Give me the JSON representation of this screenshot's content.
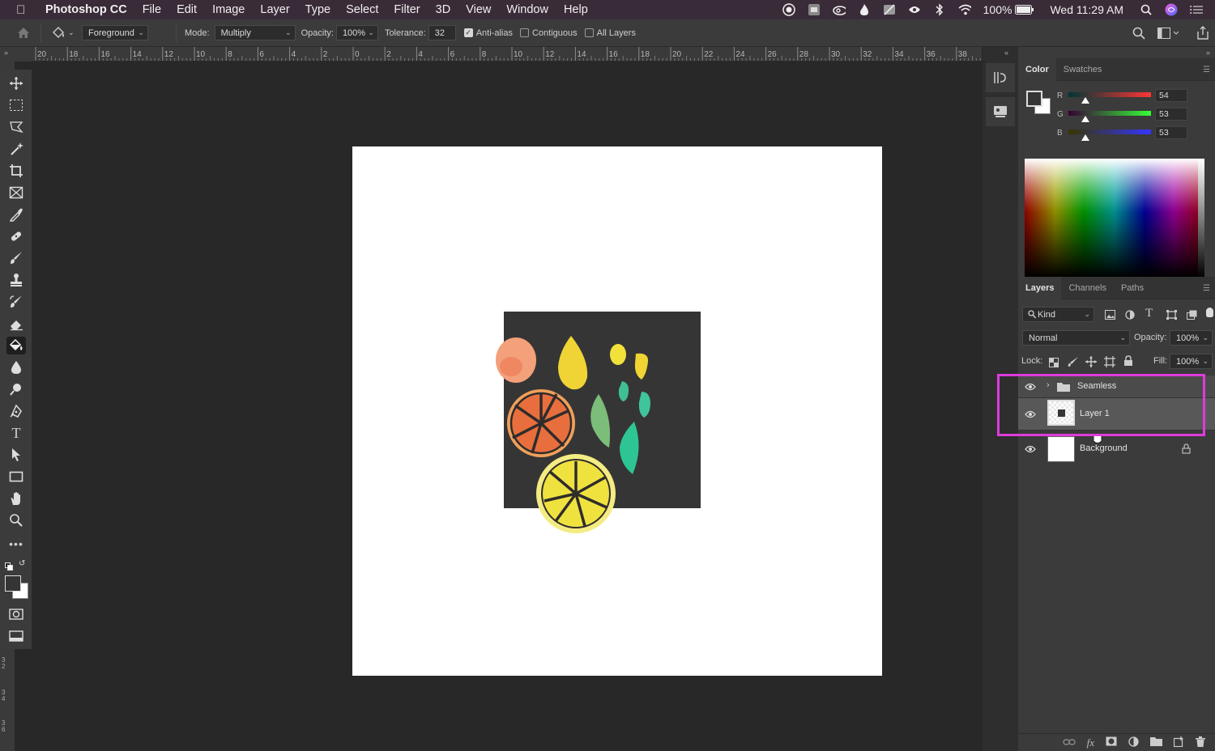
{
  "menubar": {
    "app_name": "Photoshop CC",
    "items": [
      "File",
      "Edit",
      "Image",
      "Layer",
      "Type",
      "Select",
      "Filter",
      "3D",
      "View",
      "Window",
      "Help"
    ],
    "battery": "100%",
    "clock": "Wed 11:29 AM"
  },
  "options": {
    "fill_source": "Foreground",
    "mode_label": "Mode:",
    "mode_value": "Multiply",
    "opacity_label": "Opacity:",
    "opacity_value": "100%",
    "tolerance_label": "Tolerance:",
    "tolerance_value": "32",
    "anti_alias_label": "Anti-alias",
    "anti_alias_checked": true,
    "contiguous_label": "Contiguous",
    "contiguous_checked": false,
    "all_layers_label": "All Layers",
    "all_layers_checked": false
  },
  "ruler": {
    "labels": [
      "20",
      "18",
      "16",
      "14",
      "12",
      "10",
      "8",
      "6",
      "4",
      "2",
      "0",
      "2",
      "4",
      "6",
      "8",
      "10",
      "12",
      "14",
      "16",
      "18",
      "20",
      "22",
      "24",
      "26",
      "28",
      "30",
      "32",
      "34",
      "36",
      "38"
    ]
  },
  "vruler": {
    "labels": [
      "3 2",
      "3 4",
      "3 6"
    ]
  },
  "color_panel": {
    "tabs": [
      "Color",
      "Swatches"
    ],
    "channels": [
      {
        "name": "R",
        "value": "54",
        "level": 0.21
      },
      {
        "name": "G",
        "value": "53",
        "level": 0.21
      },
      {
        "name": "B",
        "value": "53",
        "level": 0.21
      }
    ],
    "foreground": "#363535",
    "background": "#ffffff"
  },
  "layers_panel": {
    "tabs": [
      "Layers",
      "Channels",
      "Paths"
    ],
    "filter_label": "Kind",
    "blend_mode": "Normal",
    "opacity_label": "Opacity:",
    "opacity_value": "100%",
    "lock_label": "Lock:",
    "fill_label": "Fill:",
    "fill_value": "100%",
    "layers": [
      {
        "name": "Seamless",
        "kind": "group"
      },
      {
        "name": "Layer 1",
        "kind": "pixel"
      },
      {
        "name": "Background",
        "kind": "background"
      }
    ]
  },
  "colors": {
    "accent_highlight": "#de3bdc",
    "canvas_tile": "#363535"
  }
}
